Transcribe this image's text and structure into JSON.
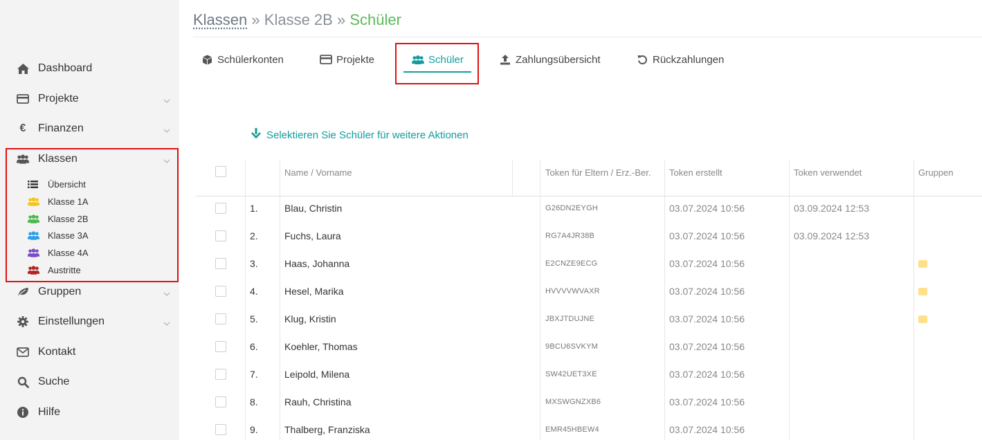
{
  "sidebar": {
    "items": [
      {
        "label": "Dashboard",
        "icon": "home-icon"
      },
      {
        "label": "Projekte",
        "icon": "credit-card-icon"
      },
      {
        "label": "Finanzen",
        "icon": "euro-icon"
      },
      {
        "label": "Klassen",
        "icon": "users-icon"
      },
      {
        "label": "Gruppen",
        "icon": "leaf-icon"
      },
      {
        "label": "Einstellungen",
        "icon": "gear-icon"
      },
      {
        "label": "Kontakt",
        "icon": "envelope-icon"
      },
      {
        "label": "Suche",
        "icon": "search-icon"
      },
      {
        "label": "Hilfe",
        "icon": "info-icon"
      }
    ],
    "klassen_sub": [
      {
        "label": "Übersicht",
        "icon": "list-icon",
        "color": "#333333"
      },
      {
        "label": "Klasse 1A",
        "icon": "users-icon",
        "color": "#f5c518"
      },
      {
        "label": "Klasse 2B",
        "icon": "users-icon",
        "color": "#4cb84c"
      },
      {
        "label": "Klasse 3A",
        "icon": "users-icon",
        "color": "#2f9ee8"
      },
      {
        "label": "Klasse 4A",
        "icon": "users-icon",
        "color": "#7a4cc7"
      },
      {
        "label": "Austritte",
        "icon": "users-icon",
        "color": "#b22222"
      }
    ]
  },
  "breadcrumb": {
    "root": "Klassen",
    "sep": "»",
    "middle": "Klasse 2B",
    "current": "Schüler"
  },
  "tabs": [
    {
      "label": "Schülerkonten",
      "icon": "cube-icon"
    },
    {
      "label": "Projekte",
      "icon": "credit-card-icon"
    },
    {
      "label": "Schüler",
      "icon": "users-icon",
      "active": true
    },
    {
      "label": "Zahlungsübersicht",
      "icon": "upload-icon"
    },
    {
      "label": "Rückzahlungen",
      "icon": "undo-icon"
    }
  ],
  "select_hint": "Selektieren Sie Schüler für weitere Aktionen",
  "table": {
    "headers": {
      "name": "Name / Vorname",
      "token": "Token für Eltern / Erz.-Ber.",
      "token_created": "Token erstellt",
      "token_used": "Token verwendet",
      "groups": "Gruppen"
    },
    "rows": [
      {
        "num": "1.",
        "name": "Blau, Christin",
        "token": "G26DN2EYGH",
        "created": "03.07.2024 10:56",
        "used": "03.09.2024 12:53",
        "group": false
      },
      {
        "num": "2.",
        "name": "Fuchs, Laura",
        "token": "RG7A4JR38B",
        "created": "03.07.2024 10:56",
        "used": "03.09.2024 12:53",
        "group": false
      },
      {
        "num": "3.",
        "name": "Haas, Johanna",
        "token": "E2CNZE9ECG",
        "created": "03.07.2024 10:56",
        "used": "",
        "group": true
      },
      {
        "num": "4.",
        "name": "Hesel, Marika",
        "token": "HVVVVWVAXR",
        "created": "03.07.2024 10:56",
        "used": "",
        "group": true
      },
      {
        "num": "5.",
        "name": "Klug, Kristin",
        "token": "JBXJTDUJNE",
        "created": "03.07.2024 10:56",
        "used": "",
        "group": true
      },
      {
        "num": "6.",
        "name": "Koehler, Thomas",
        "token": "9BCU6SVKYM",
        "created": "03.07.2024 10:56",
        "used": "",
        "group": false
      },
      {
        "num": "7.",
        "name": "Leipold, Milena",
        "token": "SW42UET3XE",
        "created": "03.07.2024 10:56",
        "used": "",
        "group": false
      },
      {
        "num": "8.",
        "name": "Rauh, Christina",
        "token": "MXSWGNZXB6",
        "created": "03.07.2024 10:56",
        "used": "",
        "group": false
      },
      {
        "num": "9.",
        "name": "Thalberg, Franziska",
        "token": "EMR45HBEW4",
        "created": "03.07.2024 10:56",
        "used": "",
        "group": false
      }
    ]
  },
  "colors": {
    "accent": "#149c9c",
    "breadcrumb_current": "#5cb85c",
    "highlight_box": "#e01010",
    "group_chip": "#ffe08a"
  }
}
